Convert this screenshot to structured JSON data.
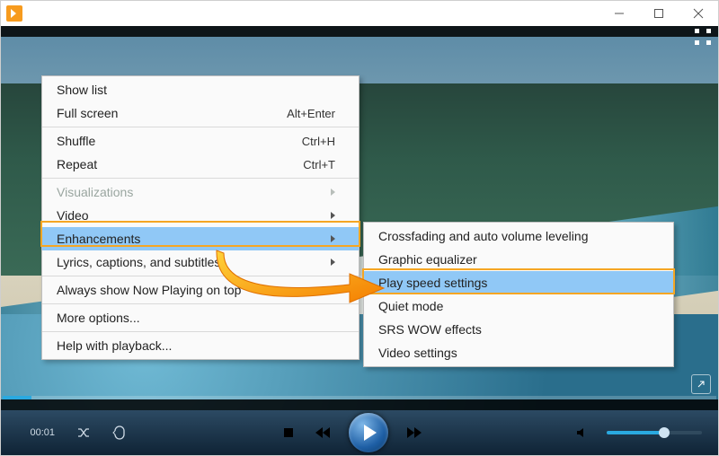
{
  "menu1": {
    "show_list": "Show list",
    "full_screen": "Full screen",
    "full_screen_shortcut": "Alt+Enter",
    "shuffle": "Shuffle",
    "shuffle_shortcut": "Ctrl+H",
    "repeat": "Repeat",
    "repeat_shortcut": "Ctrl+T",
    "visualizations": "Visualizations",
    "video": "Video",
    "enhancements": "Enhancements",
    "lyrics": "Lyrics, captions, and subtitles",
    "always_top": "Always show Now Playing on top",
    "more_options": "More options...",
    "help": "Help with playback..."
  },
  "menu2": {
    "crossfading": "Crossfading and auto volume leveling",
    "graphic_eq": "Graphic equalizer",
    "play_speed": "Play speed settings",
    "quiet_mode": "Quiet mode",
    "srs_wow": "SRS WOW effects",
    "video_settings": "Video settings"
  },
  "controls": {
    "time": "00:01"
  }
}
